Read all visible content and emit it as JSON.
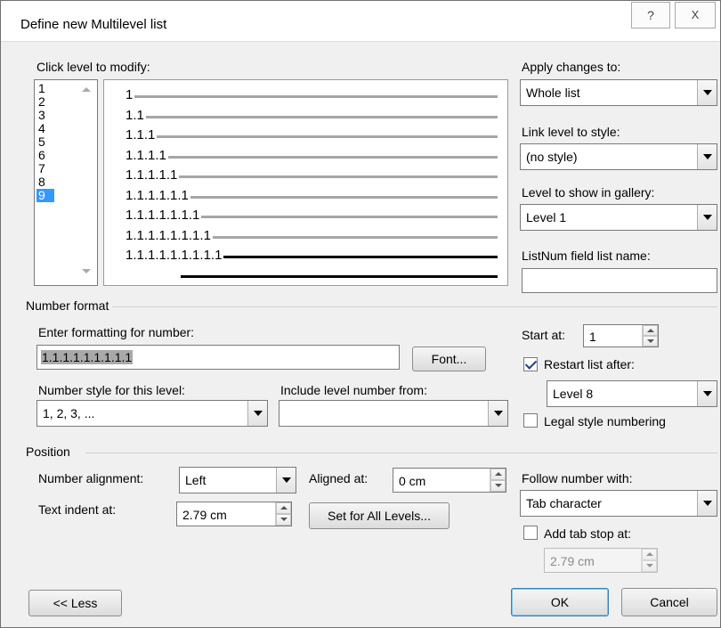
{
  "window": {
    "title": "Define new Multilevel list",
    "help_label": "?",
    "close_label": "X"
  },
  "levels": {
    "label": "Click level to modify:",
    "items": [
      "1",
      "2",
      "3",
      "4",
      "5",
      "6",
      "7",
      "8",
      "9"
    ],
    "selected": "9"
  },
  "preview": {
    "rows": [
      "1",
      "1.1",
      "1.1.1",
      "1.1.1.1",
      "1.1.1.1.1",
      "1.1.1.1.1.1",
      "1.1.1.1.1.1.1",
      "1.1.1.1.1.1.1.1",
      "1.1.1.1.1.1.1.1.1"
    ]
  },
  "apply_changes": {
    "label": "Apply changes to:",
    "value": "Whole list"
  },
  "link_level": {
    "label": "Link level to style:",
    "value": "(no style)"
  },
  "level_gallery": {
    "label": "Level to show in gallery:",
    "value": "Level 1"
  },
  "listnum": {
    "label": "ListNum field list name:",
    "value": ""
  },
  "number_format": {
    "section": "Number format",
    "enter_label": "Enter formatting for number:",
    "format_value": "1.1.1.1.1.1.1.1.1",
    "font_button": "Font...",
    "style_label": "Number style for this level:",
    "style_value": "1, 2, 3, ...",
    "include_label": "Include level number from:",
    "include_value": "",
    "start_label": "Start at:",
    "start_value": "1",
    "restart_label": "Restart list after:",
    "restart_checked": true,
    "restart_value": "Level 8",
    "legal_label": "Legal style numbering",
    "legal_checked": false
  },
  "position": {
    "section": "Position",
    "alignment_label": "Number alignment:",
    "alignment_value": "Left",
    "aligned_at_label": "Aligned at:",
    "aligned_at_value": "0 cm",
    "indent_label": "Text indent at:",
    "indent_value": "2.79 cm",
    "set_all_button": "Set for All Levels...",
    "follow_label": "Follow number with:",
    "follow_value": "Tab character",
    "tabstop_label": "Add tab stop at:",
    "tabstop_checked": false,
    "tabstop_value": "2.79 cm"
  },
  "footer": {
    "less_button": "<< Less",
    "ok_button": "OK",
    "cancel_button": "Cancel"
  }
}
